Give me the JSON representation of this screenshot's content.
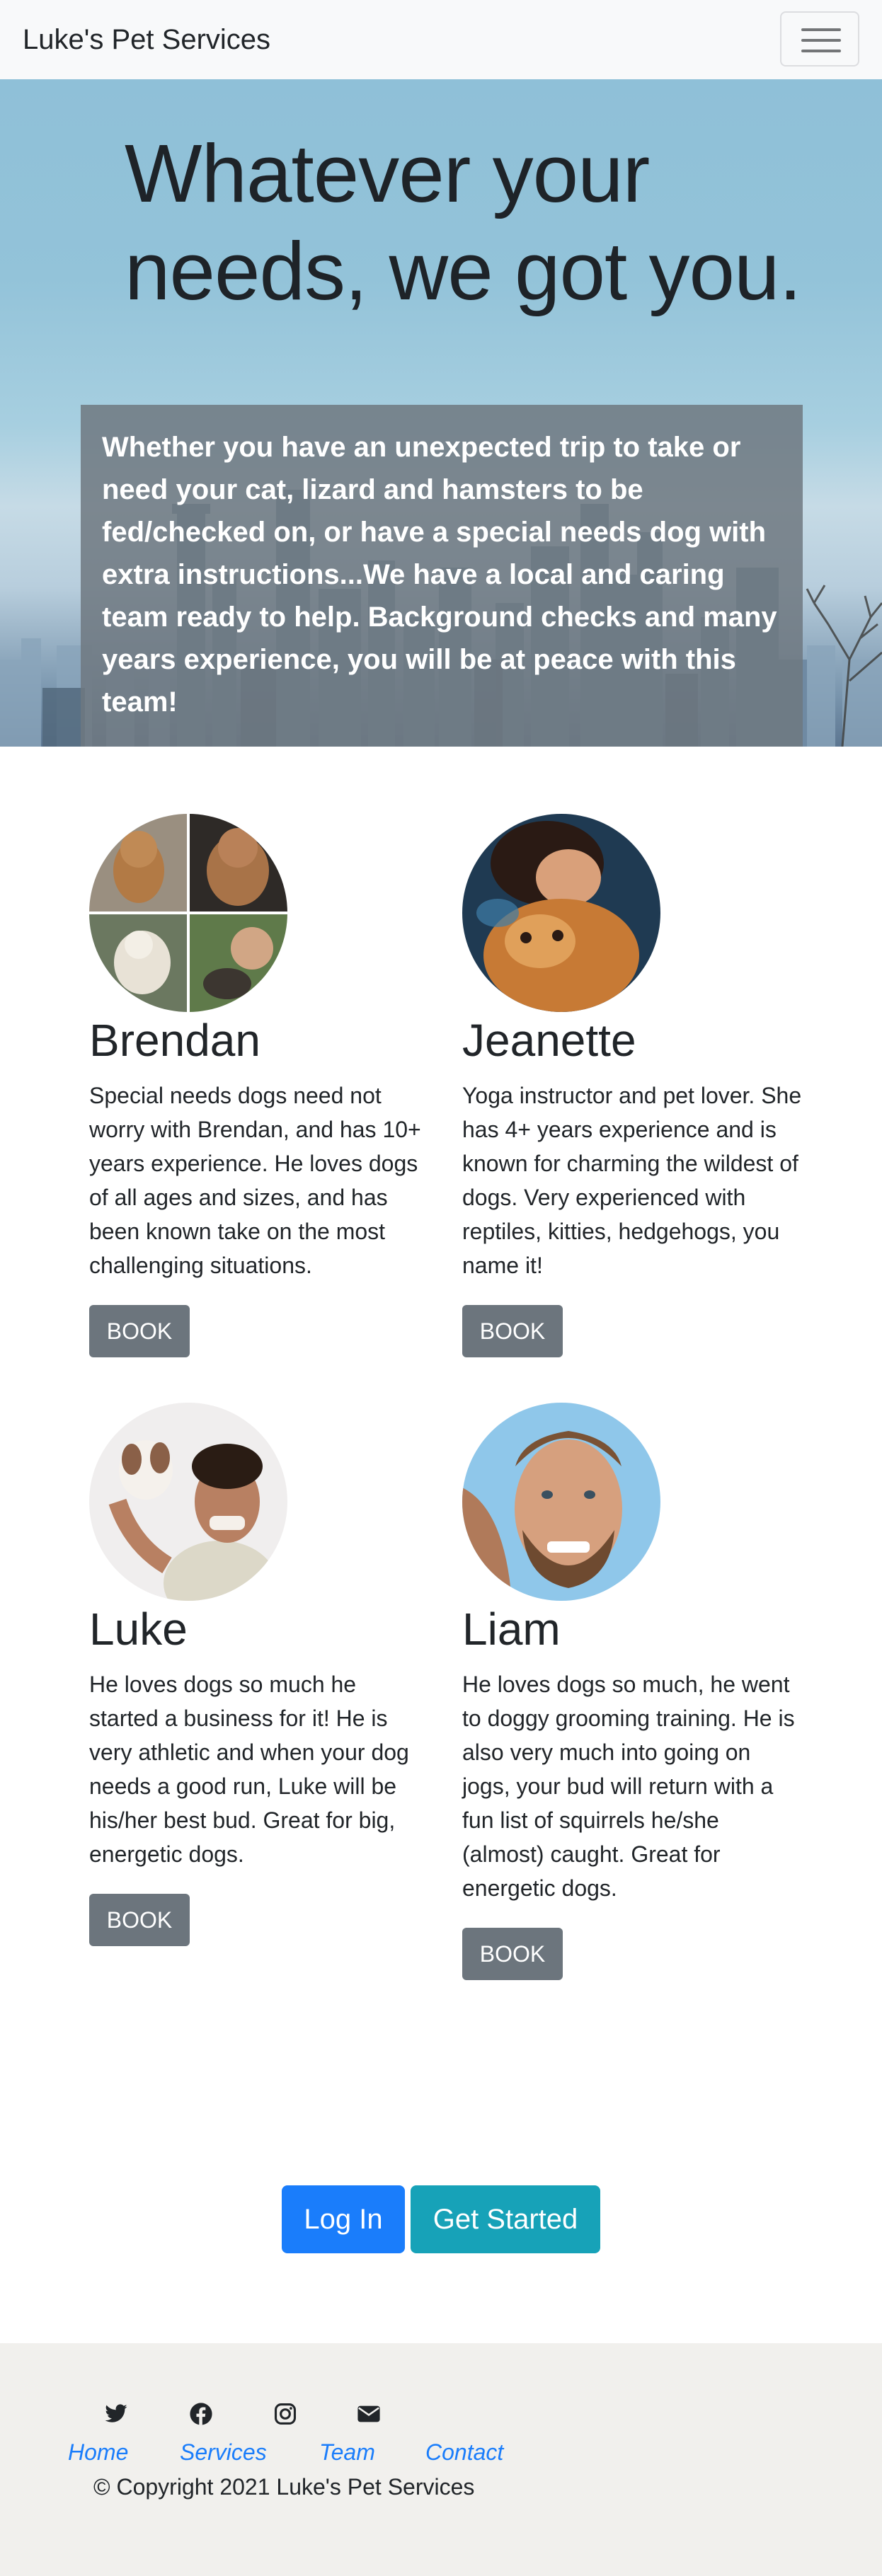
{
  "navbar": {
    "brand": "Luke's Pet Services",
    "menu_icon": "hamburger-menu-icon"
  },
  "hero": {
    "title": "Whatever your needs, we got you.",
    "description": "Whether you have an unexpected trip to take or need your cat, lizard and hamsters to be fed/checked on, or have a special needs dog with extra instructions...We have a local and caring team ready to help. Background checks and many years experience, you will be at peace with this team!"
  },
  "team": [
    {
      "name": "Brendan",
      "bio": "Special needs dogs need not worry with Brendan, and has 10+ years experience. He loves dogs of all ages and sizes, and has been known take on the most challenging situations.",
      "button": "BOOK"
    },
    {
      "name": "Jeanette",
      "bio": "Yoga instructor and pet lover. She has 4+ years experience and is known for charming the wildest of dogs. Very experienced with reptiles, kitties, hedgehogs, you name it!",
      "button": "BOOK"
    },
    {
      "name": "Luke",
      "bio": "He loves dogs so much he started a business for it! He is very athletic and when your dog needs a good run, Luke will be his/her best bud. Great for big, energetic dogs.",
      "button": "BOOK"
    },
    {
      "name": "Liam",
      "bio": "He loves dogs so much, he went to doggy grooming training. He is also very much into going on jogs, your bud will return with a fun list of squirrels he/she (almost) caught. Great for energetic dogs.",
      "button": "BOOK"
    }
  ],
  "cta": {
    "login": "Log In",
    "get_started": "Get Started",
    "login_color": "#1a7dfb",
    "start_color": "#17a2b8"
  },
  "footer": {
    "social_icons": [
      "twitter-icon",
      "facebook-icon",
      "instagram-icon",
      "envelope-icon"
    ],
    "links": [
      "Home",
      "Services",
      "Team",
      "Contact"
    ],
    "copyright": "© Copyright 2021 Luke's Pet Services",
    "link_color": "#1a7dfb"
  }
}
